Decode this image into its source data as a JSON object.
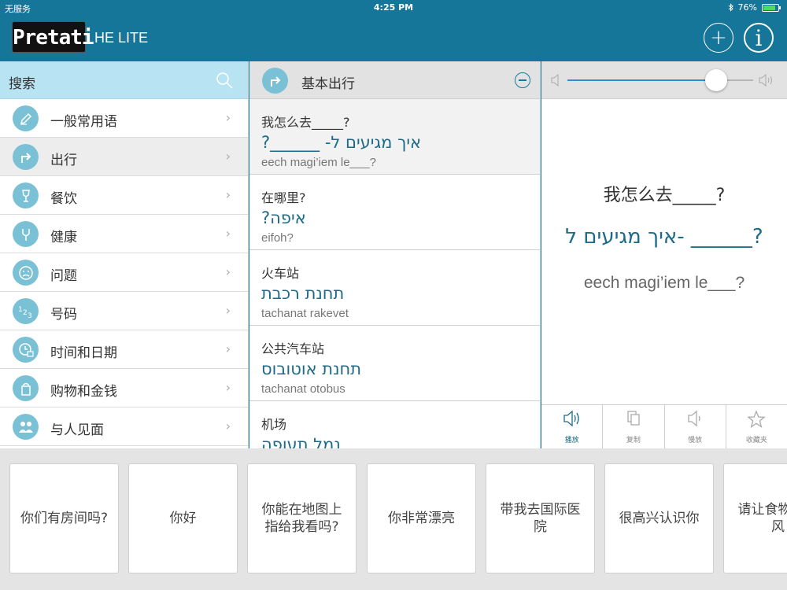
{
  "status": {
    "carrier": "无服务",
    "time": "4:25 PM",
    "battery": "76%",
    "battery_level": 0.76
  },
  "header": {
    "logo": "Pretati",
    "subtitle": "HE LITE",
    "add_label": "+",
    "info_label": "i"
  },
  "sidebar": {
    "search_label": "搜索",
    "items": [
      {
        "label": "一般常用语",
        "icon": "pencil-icon"
      },
      {
        "label": "出行",
        "icon": "turn-right-arrow-icon"
      },
      {
        "label": "餐饮",
        "icon": "wine-glass-icon"
      },
      {
        "label": "健康",
        "icon": "stethoscope-icon"
      },
      {
        "label": "问题",
        "icon": "frown-face-icon"
      },
      {
        "label": "号码",
        "icon": "numbers-icon"
      },
      {
        "label": "时间和日期",
        "icon": "clock-calendar-icon"
      },
      {
        "label": "购物和金钱",
        "icon": "shopping-bag-icon"
      },
      {
        "label": "与人见面",
        "icon": "people-icon"
      }
    ],
    "chevron": "›"
  },
  "phrases": {
    "category_title": "基本出行",
    "items": [
      {
        "zh": "我怎么去_____?",
        "he": "איך מגיעים ל- ______?",
        "translit": "eech magi’iem le___?"
      },
      {
        "zh": "在哪里?",
        "he": "איפה?",
        "translit": "eifoh?"
      },
      {
        "zh": "火车站",
        "he": "תחנת רכבת",
        "translit": "tachanat rakevet"
      },
      {
        "zh": "公共汽车站",
        "he": "תחנת אוטובוס",
        "translit": "tachanat otobus"
      },
      {
        "zh": "机场",
        "he": "נמל תעופה",
        "translit": ""
      }
    ]
  },
  "detail": {
    "zh": "我怎么去_____?",
    "he": "איך מגיעים ל- ______?",
    "translit": "eech magi’iem le___?",
    "volume": 0.8,
    "actions": [
      {
        "label": "播放",
        "icon": "speaker-icon"
      },
      {
        "label": "复制",
        "icon": "copy-icon"
      },
      {
        "label": "慢放",
        "icon": "slow-speaker-icon"
      },
      {
        "label": "收藏夹",
        "icon": "star-icon"
      }
    ]
  },
  "quick_phrases": [
    "你们有房间吗?",
    "你好",
    "你能在地图上指给我看吗?",
    "你非常漂亮",
    "带我去国际医院",
    "很高兴认识你",
    "请让食物辛辣风"
  ]
}
